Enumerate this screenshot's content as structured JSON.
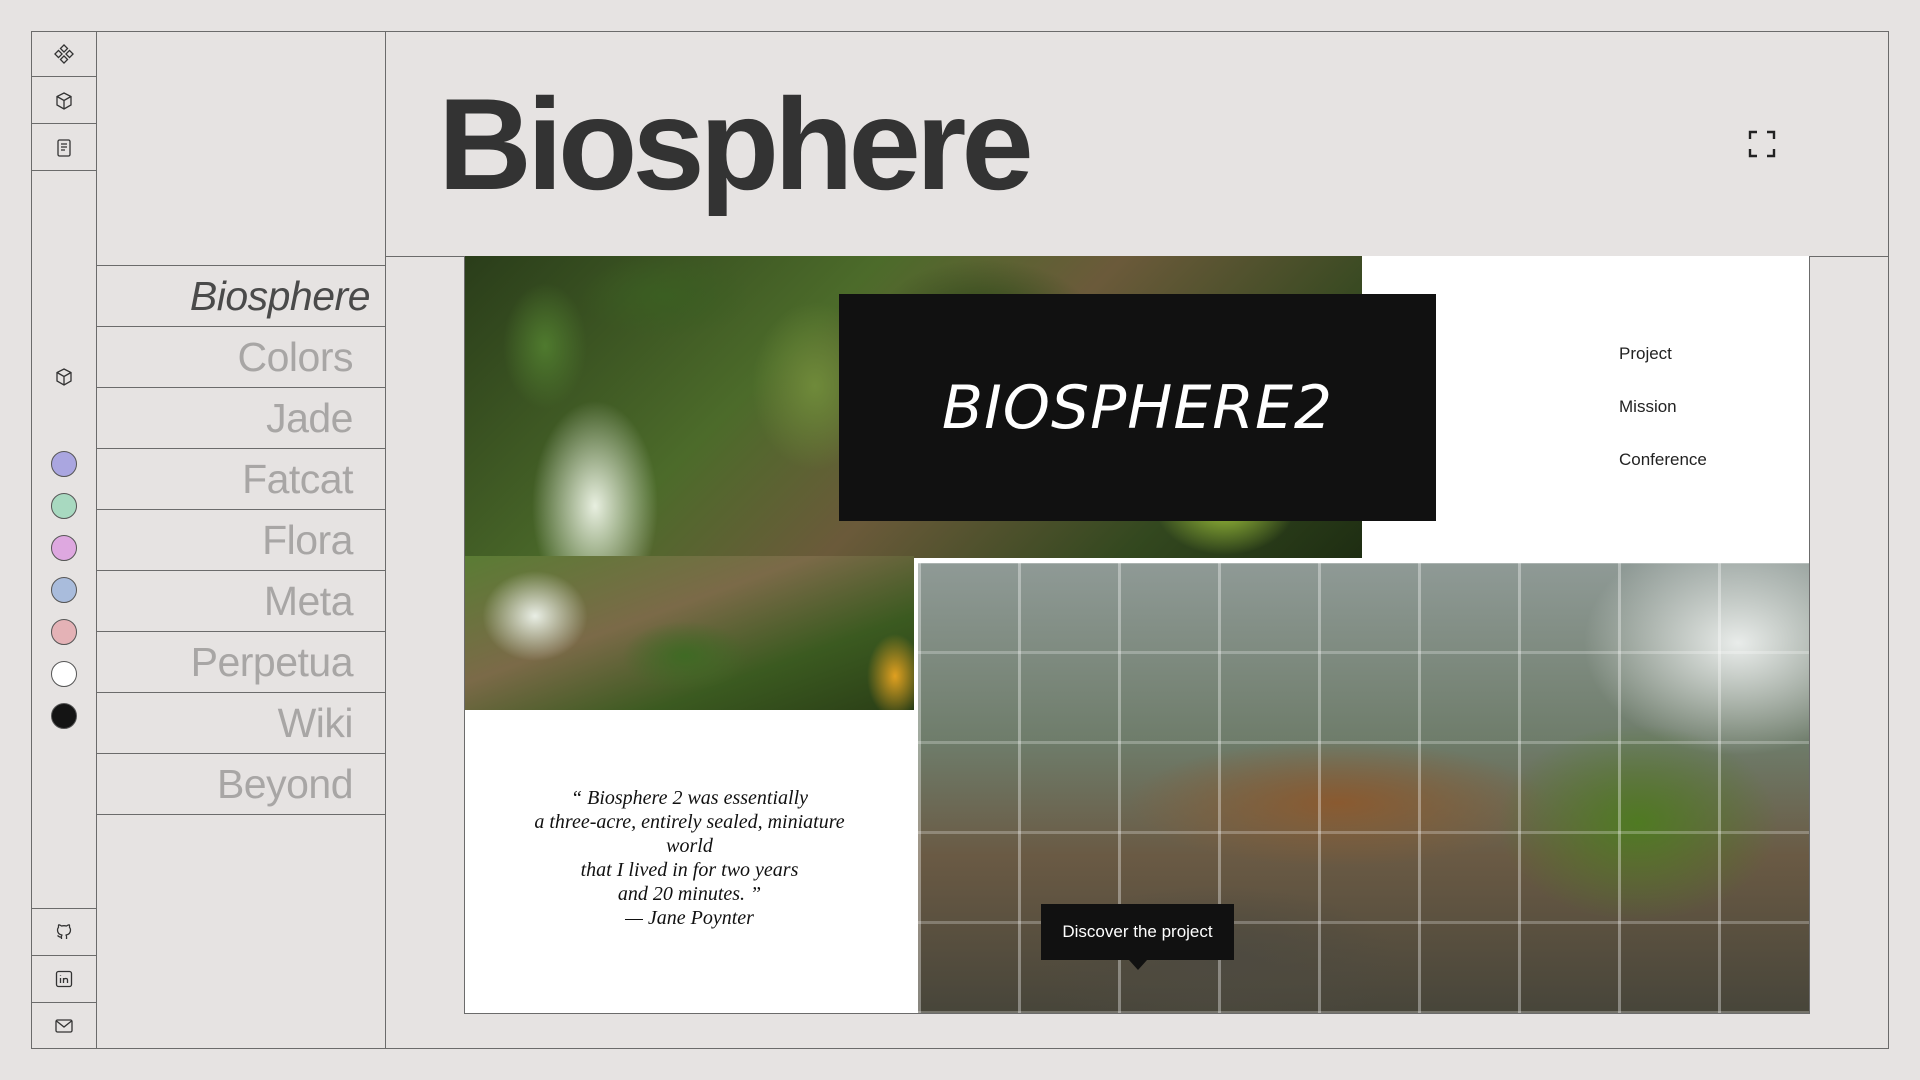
{
  "header": {
    "title": "Biosphere"
  },
  "nav": {
    "items": [
      {
        "label": "Biosphere"
      },
      {
        "label": "Colors"
      },
      {
        "label": "Jade"
      },
      {
        "label": "Fatcat"
      },
      {
        "label": "Flora"
      },
      {
        "label": "Meta"
      },
      {
        "label": "Perpetua"
      },
      {
        "label": "Wiki"
      },
      {
        "label": "Beyond"
      }
    ],
    "active_index": 0
  },
  "rail": {
    "top_icons": [
      "grid-icon",
      "cube-icon",
      "document-icon"
    ],
    "middle_icon": "cube-icon",
    "bottom_icons": [
      "github-icon",
      "linkedin-icon",
      "mail-icon"
    ],
    "swatches": [
      "#aaa6e0",
      "#a8d9c0",
      "#dea8e0",
      "#a9bcdc",
      "#e4b2b6",
      "#ffffff",
      "#141414"
    ]
  },
  "card": {
    "brand": "BIOSPHERE2",
    "links": [
      "Project",
      "Mission",
      "Conference"
    ],
    "quote_lines": [
      "“ Biosphere 2 was essentially",
      "a three-acre, entirely sealed, miniature",
      "world",
      "that I lived in for two years",
      "and 20 minutes. ”",
      "— Jane Poynter"
    ],
    "cta": "Discover the project"
  }
}
